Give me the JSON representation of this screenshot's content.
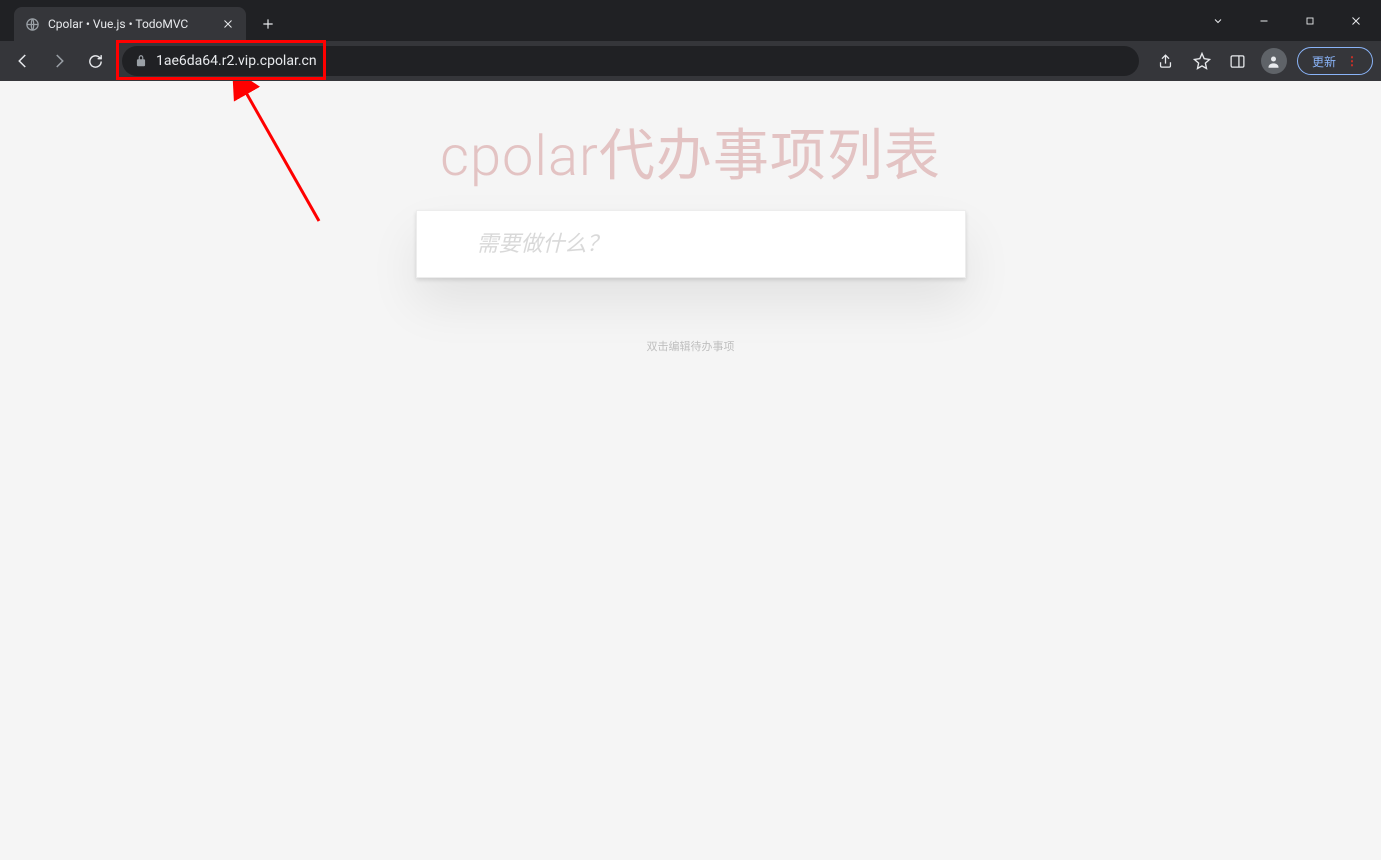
{
  "browser": {
    "tab": {
      "title": "Cpolar • Vue.js • TodoMVC"
    },
    "url": "1ae6da64.r2.vip.cpolar.cn",
    "update_button_label": "更新"
  },
  "app": {
    "heading": "cpolar代办事项列表",
    "input_placeholder": "需要做什么？",
    "footer_hint": "双击编辑待办事项"
  }
}
